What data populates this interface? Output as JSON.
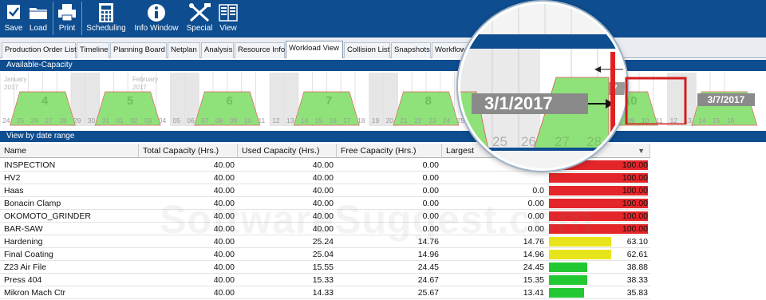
{
  "toolbar": {
    "buttons": [
      {
        "label": "Save",
        "icon": "save-icon"
      },
      {
        "label": "Load",
        "icon": "folder-icon"
      },
      {
        "label": "Print",
        "icon": "printer-icon"
      },
      {
        "label": "Scheduling",
        "icon": "calculator-icon"
      },
      {
        "label": "Info Window",
        "icon": "info-icon"
      },
      {
        "label": "Special",
        "icon": "tools-icon"
      },
      {
        "label": "View",
        "icon": "view-icon"
      }
    ]
  },
  "tabs": [
    {
      "label": "Production Order List"
    },
    {
      "label": "Timeline"
    },
    {
      "label": "Planning Board"
    },
    {
      "label": "Netplan"
    },
    {
      "label": "Analysis"
    },
    {
      "label": "Resource Info"
    },
    {
      "label": "Workload View",
      "active": true
    },
    {
      "label": "Collision List"
    },
    {
      "label": "Snapshots"
    },
    {
      "label": "Workflows"
    }
  ],
  "capacity_panel": {
    "title": "Available-Capacity",
    "months": [
      "January 2017",
      "February 2017"
    ],
    "weeks": [
      "4",
      "5",
      "6",
      "7",
      "8",
      "9",
      "10"
    ],
    "days": [
      "24",
      "25",
      "26",
      "27",
      "28",
      "29",
      "30",
      "31",
      "01",
      "02",
      "03",
      "04",
      "05",
      "06",
      "07",
      "08",
      "09",
      "10",
      "11",
      "12",
      "13",
      "14",
      "15",
      "16",
      "17",
      "18",
      "19",
      "20",
      "21",
      "22",
      "23",
      "24",
      "25",
      "26",
      "27",
      "28",
      "01",
      "02",
      "03",
      "04",
      "05",
      "06",
      "07",
      "08",
      "09",
      "10",
      "11",
      "12",
      "13",
      "14",
      "15",
      "16"
    ],
    "magnifier": {
      "date_callout_1": "3/1/2017",
      "date_callout_2": "3/7/2017",
      "small_label": "7",
      "days": [
        "25",
        "26",
        "27",
        "28"
      ]
    }
  },
  "table": {
    "title": "View by date range",
    "columns": [
      "Name",
      "Total Capacity (Hrs.)",
      "Used Capacity (Hrs.)",
      "Free Capacity (Hrs.)",
      "Largest"
    ],
    "rows": [
      {
        "name": "INSPECTION",
        "total": "40.00",
        "used": "40.00",
        "free": "0.00",
        "largest": "",
        "pct_text": "100.00",
        "pct": 100,
        "color": "#e4262a"
      },
      {
        "name": "HV2",
        "total": "40.00",
        "used": "40.00",
        "free": "0.00",
        "largest": "",
        "pct_text": "100.00",
        "pct": 100,
        "color": "#e4262a"
      },
      {
        "name": "Haas",
        "total": "40.00",
        "used": "40.00",
        "free": "0.00",
        "largest": "0.0",
        "pct_text": "100.00",
        "pct": 100,
        "color": "#e4262a"
      },
      {
        "name": "Bonacin Clamp",
        "total": "40.00",
        "used": "40.00",
        "free": "0.00",
        "largest": "0.00",
        "pct_text": "100.00",
        "pct": 100,
        "color": "#e4262a"
      },
      {
        "name": "OKOMOTO_GRINDER",
        "total": "40.00",
        "used": "40.00",
        "free": "0.00",
        "largest": "0.00",
        "pct_text": "100.00",
        "pct": 100,
        "color": "#e4262a"
      },
      {
        "name": "BAR-SAW",
        "total": "40.00",
        "used": "40.00",
        "free": "0.00",
        "largest": "0.00",
        "pct_text": "100.00",
        "pct": 100,
        "color": "#e4262a"
      },
      {
        "name": "Hardening",
        "total": "40.00",
        "used": "25.24",
        "free": "14.76",
        "largest": "14.76",
        "pct_text": "63.10",
        "pct": 63.1,
        "color": "#e8e41b"
      },
      {
        "name": "Final Coating",
        "total": "40.00",
        "used": "25.04",
        "free": "14.96",
        "largest": "14.96",
        "pct_text": "62.61",
        "pct": 62.61,
        "color": "#e8e41b"
      },
      {
        "name": "Z23 Air File",
        "total": "40.00",
        "used": "15.55",
        "free": "24.45",
        "largest": "24.45",
        "pct_text": "38.88",
        "pct": 38.88,
        "color": "#22c832"
      },
      {
        "name": "Press 404",
        "total": "40.00",
        "used": "15.33",
        "free": "24.67",
        "largest": "15.35",
        "pct_text": "38.33",
        "pct": 38.33,
        "color": "#22c832"
      },
      {
        "name": "Mikron Mach Ctr",
        "total": "40.00",
        "used": "14.33",
        "free": "25.67",
        "largest": "13.41",
        "pct_text": "35.83",
        "pct": 35.83,
        "color": "#22c832"
      }
    ]
  },
  "watermark": "SoftwareSuggest.com"
}
